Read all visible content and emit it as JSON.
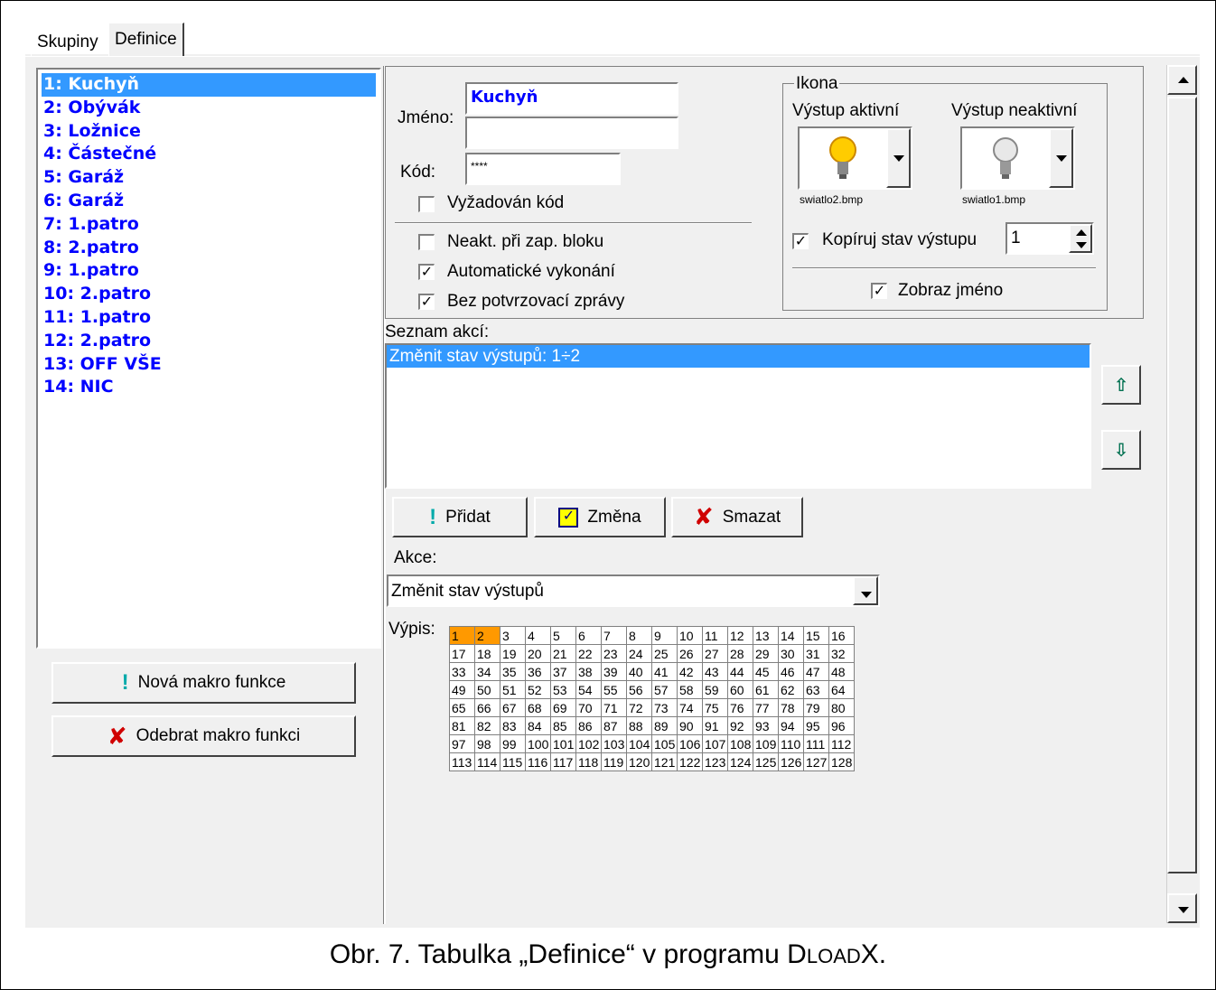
{
  "tabs": [
    "Skupiny",
    "Definice"
  ],
  "macros": [
    "1: Kuchyň",
    "2: Obývák",
    "3: Ložnice",
    "4: Částečné",
    "5: Garáž",
    "6: Garáž",
    "7: 1.patro",
    "8: 2.patro",
    "9: 1.patro",
    "10: 2.patro",
    "11: 1.patro",
    "12: 2.patro",
    "13: OFF VŠE",
    "14: NIC"
  ],
  "selected_macro": "1: Kuchyň",
  "left_buttons": {
    "new": "Nová makro funkce",
    "remove": "Odebrat makro funkci"
  },
  "form": {
    "name_label": "Jméno:",
    "name_value": "Kuchyň",
    "name_value2": "",
    "code_label": "Kód:",
    "code_value": "****",
    "code_required": "Vyžadován kód",
    "inactive_block": "Neakt. při zap. bloku",
    "auto_exec": "Automatické vykonání",
    "no_confirm": "Bez potvrzovací zprávy"
  },
  "icon_group": {
    "title": "Ikona",
    "active_label": "Výstup aktivní",
    "inactive_label": "Výstup neaktivní",
    "active_file": "swiatlo2.bmp",
    "inactive_file": "swiatlo1.bmp",
    "copy_state": "Kopíruj stav výstupu",
    "copy_value": "1",
    "show_name": "Zobraz jméno"
  },
  "actions": {
    "list_label": "Seznam akcí:",
    "items": [
      "Změnit stav výstupů: 1÷2"
    ],
    "add": "Přidat",
    "change": "Změna",
    "delete": "Smazat",
    "action_label": "Akce:",
    "action_value": "Změnit stav výstupů",
    "list2_label": "Výpis:"
  },
  "outputs_selected": [
    1,
    2
  ],
  "outputs_count": 128,
  "caption": {
    "main": "Obr. 7. Tabulka „Definice“ v programu D",
    "small": "LOAD",
    "end": "X."
  },
  "colors": {
    "selection": "#3399ff",
    "macro_text": "#0000ff",
    "output_on": "#ff9900"
  }
}
